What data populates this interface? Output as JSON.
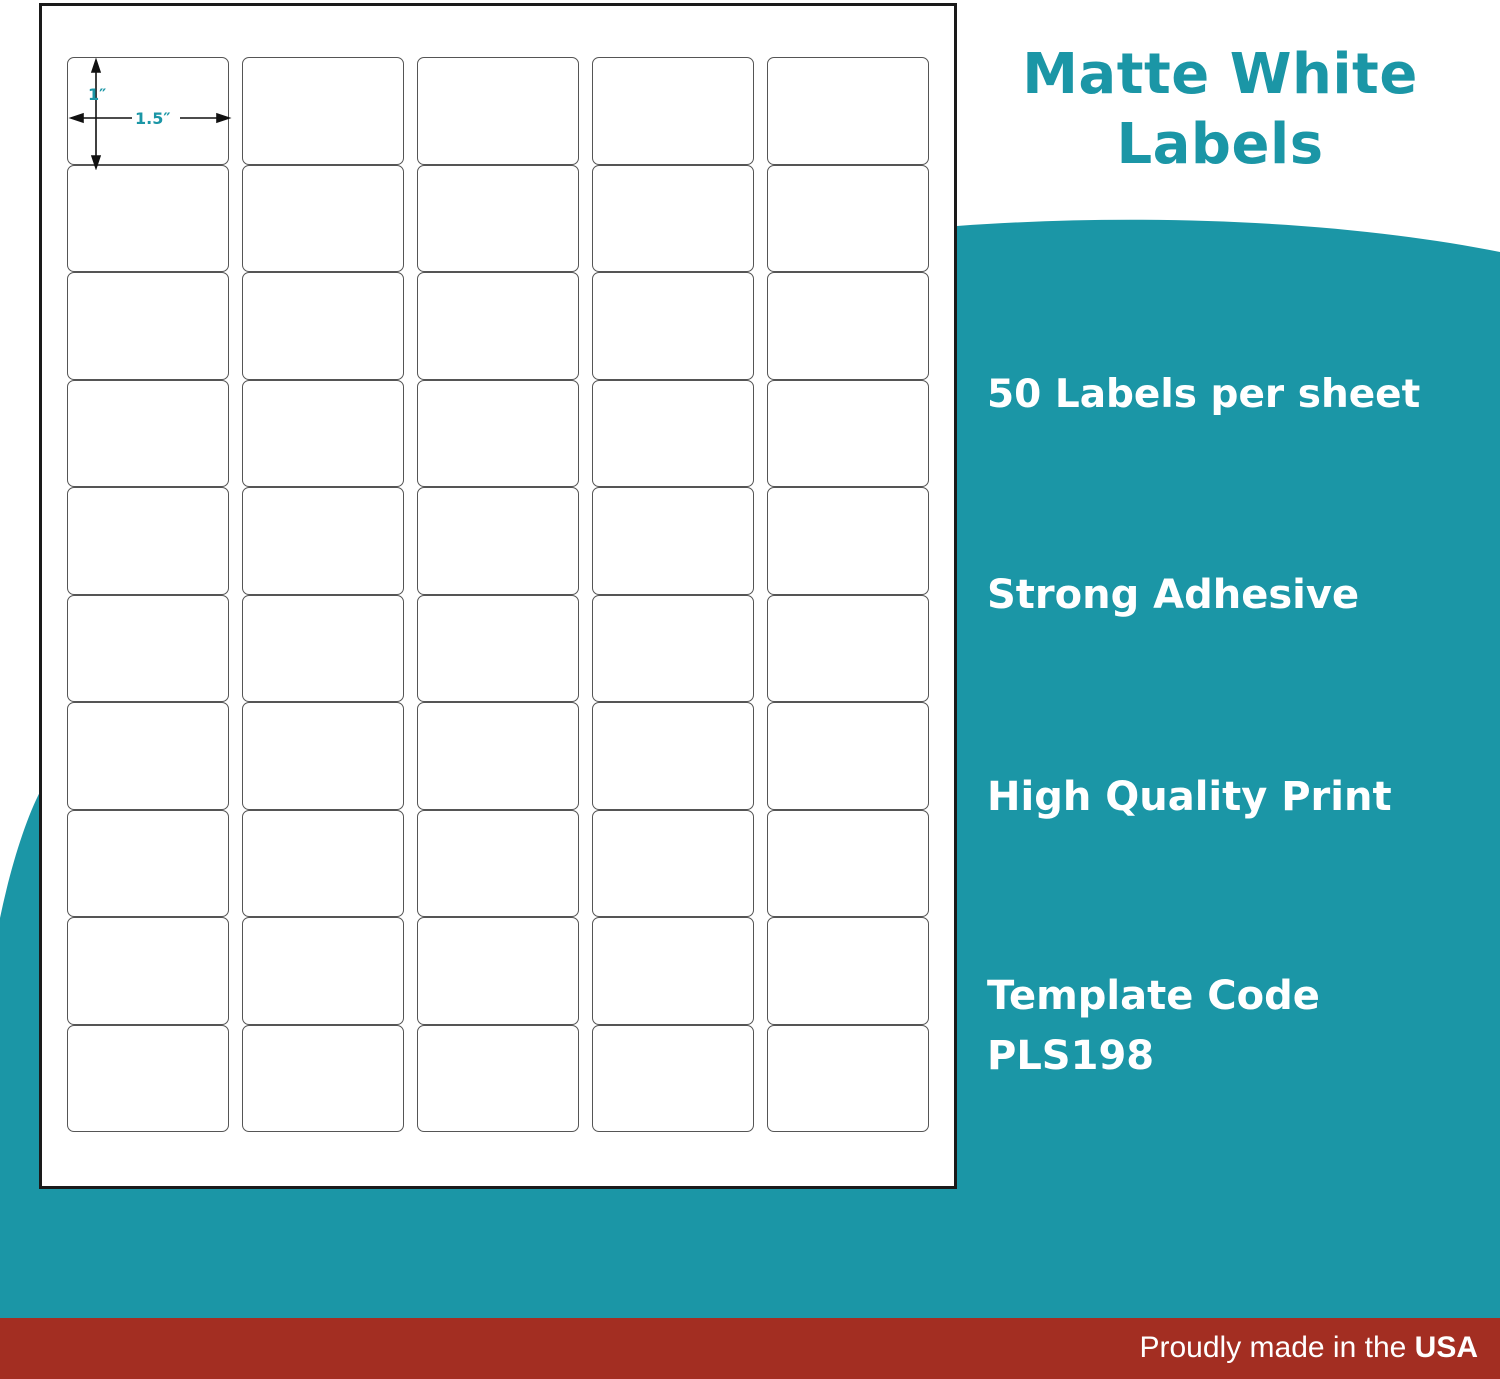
{
  "background": {
    "teal": "#1b96a6",
    "white": "#ffffff",
    "footer_red": "#a32e22"
  },
  "sheet": {
    "rows": 10,
    "columns": 5,
    "height_label": "1″",
    "width_label": "1.5″"
  },
  "title": {
    "line1": "Matte White",
    "line2": "Labels"
  },
  "features": {
    "item1": "50 Labels per sheet",
    "item2": "Strong Adhesive",
    "item3": "High Quality Print",
    "item4_line1": "Template Code",
    "item4_line2": "PLS198"
  },
  "footer": {
    "text": "Proudly made in the",
    "emphasis": "USA"
  }
}
